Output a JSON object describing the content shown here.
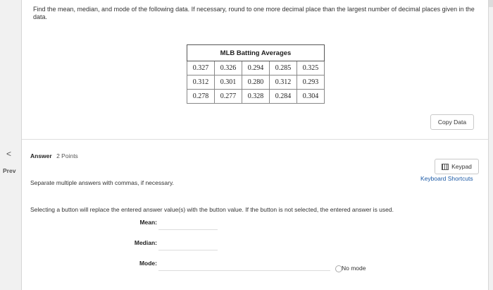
{
  "question": {
    "text": "Find the mean, median, and mode of the following data. If necessary, round to one more decimal place than the largest number of decimal places given in the data."
  },
  "table": {
    "title": "MLB Batting Averages",
    "rows": [
      [
        "0.327",
        "0.326",
        "0.294",
        "0.285",
        "0.325"
      ],
      [
        "0.312",
        "0.301",
        "0.280",
        "0.312",
        "0.293"
      ],
      [
        "0.278",
        "0.277",
        "0.328",
        "0.284",
        "0.304"
      ]
    ]
  },
  "buttons": {
    "copy_data": "Copy Data",
    "keypad": "Keypad",
    "keyboard_shortcuts": "Keyboard Shortcuts"
  },
  "nav": {
    "prev_arrow": "<",
    "prev_label": "Prev"
  },
  "answer": {
    "label": "Answer",
    "points": "2 Points",
    "hint_separate": "Separate multiple answers with commas, if necessary.",
    "hint_button": "Selecting a button will replace the entered answer value(s) with the button value. If the button is not selected, the entered answer is used.",
    "mean_label": "Mean:",
    "median_label": "Median:",
    "mode_label": "Mode:",
    "mean_value": "",
    "median_value": "",
    "mode_value": "",
    "no_mode_label": "No mode"
  }
}
